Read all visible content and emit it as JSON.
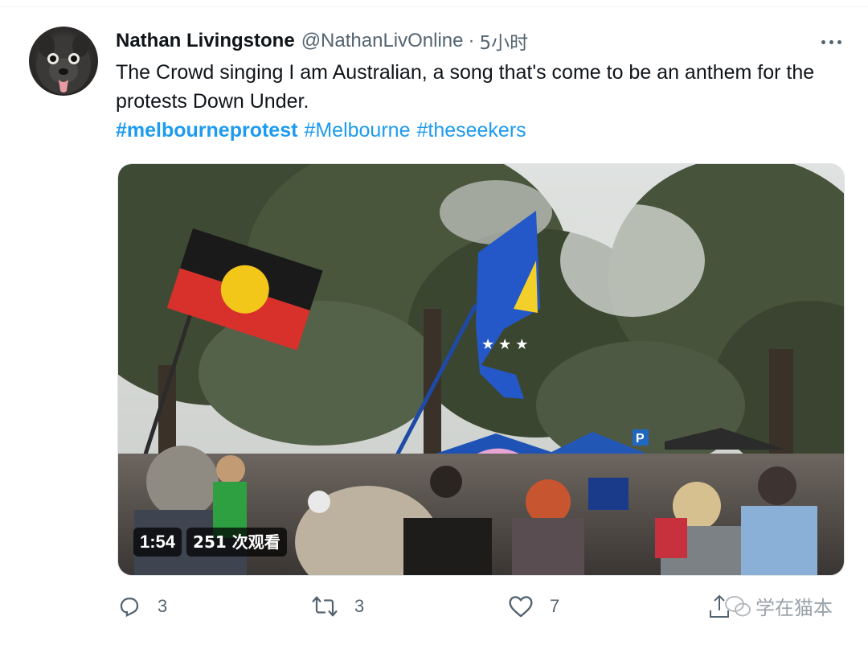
{
  "tweet": {
    "author": {
      "display_name": "Nathan Livingstone",
      "handle": "@NathanLivOnline",
      "separator": "·",
      "time": "5小时"
    },
    "more_icon": "more-horizontal-icon",
    "text": "The Crowd singing I am Australian, a song that's come to be an anthem for the protests Down Under.",
    "hashtags": [
      "#melbourneprotest",
      "#Melbourne",
      "#theseekers"
    ],
    "media": {
      "type": "video",
      "duration": "1:54",
      "views": "251 次观看"
    },
    "actions": {
      "reply_count": "3",
      "retweet_count": "3",
      "like_count": "7"
    },
    "accent_color": "#1d9bf0",
    "text_color": "#0f1419",
    "muted_color": "#536471"
  },
  "watermark": {
    "text": "学在猫本",
    "icon": "wechat-icon"
  }
}
